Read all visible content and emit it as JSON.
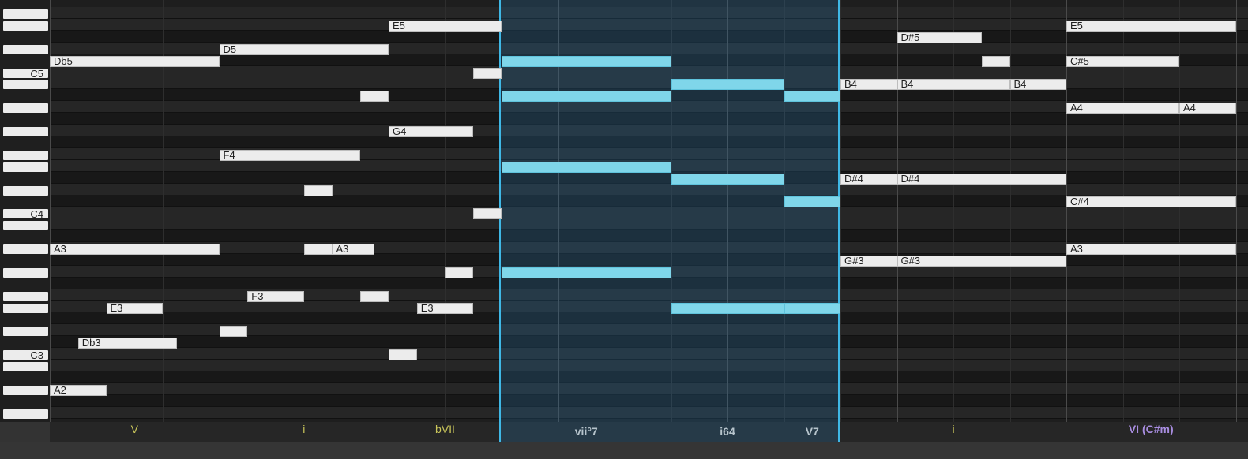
{
  "piano_roll": {
    "octave_labels": [
      "C5",
      "C4",
      "C3"
    ],
    "notes_left": [
      {
        "label": "Db5"
      },
      {
        "label": "A3"
      },
      {
        "label": "E3"
      },
      {
        "label": "Db3"
      },
      {
        "label": "A2"
      },
      {
        "label": "D5"
      },
      {
        "label": "F4"
      },
      {
        "label": "A3"
      },
      {
        "label": "F3"
      },
      {
        "label": "E5"
      },
      {
        "label": "G4"
      },
      {
        "label": "E3"
      }
    ],
    "notes_right": [
      {
        "label": "D#5"
      },
      {
        "label": "B4"
      },
      {
        "label": "B4"
      },
      {
        "label": "B4"
      },
      {
        "label": "D#4"
      },
      {
        "label": "D#4"
      },
      {
        "label": "G#3"
      },
      {
        "label": "G#3"
      },
      {
        "label": "E5"
      },
      {
        "label": "C#5"
      },
      {
        "label": "A4"
      },
      {
        "label": "A4"
      },
      {
        "label": "C#4"
      },
      {
        "label": "A3"
      }
    ]
  },
  "chords": [
    {
      "label": "V"
    },
    {
      "label": "i"
    },
    {
      "label": "bVII"
    },
    {
      "label": "vii°7"
    },
    {
      "label": "i64"
    },
    {
      "label": "V7"
    },
    {
      "label": "i"
    },
    {
      "label": "VI (C#m)"
    }
  ],
  "colors": {
    "note": "#ececec",
    "selected_note": "#7fd6ea",
    "selection_border": "#3fb8e6",
    "chord_text": "#c9c55a",
    "modulation_text": "#a88de0"
  }
}
